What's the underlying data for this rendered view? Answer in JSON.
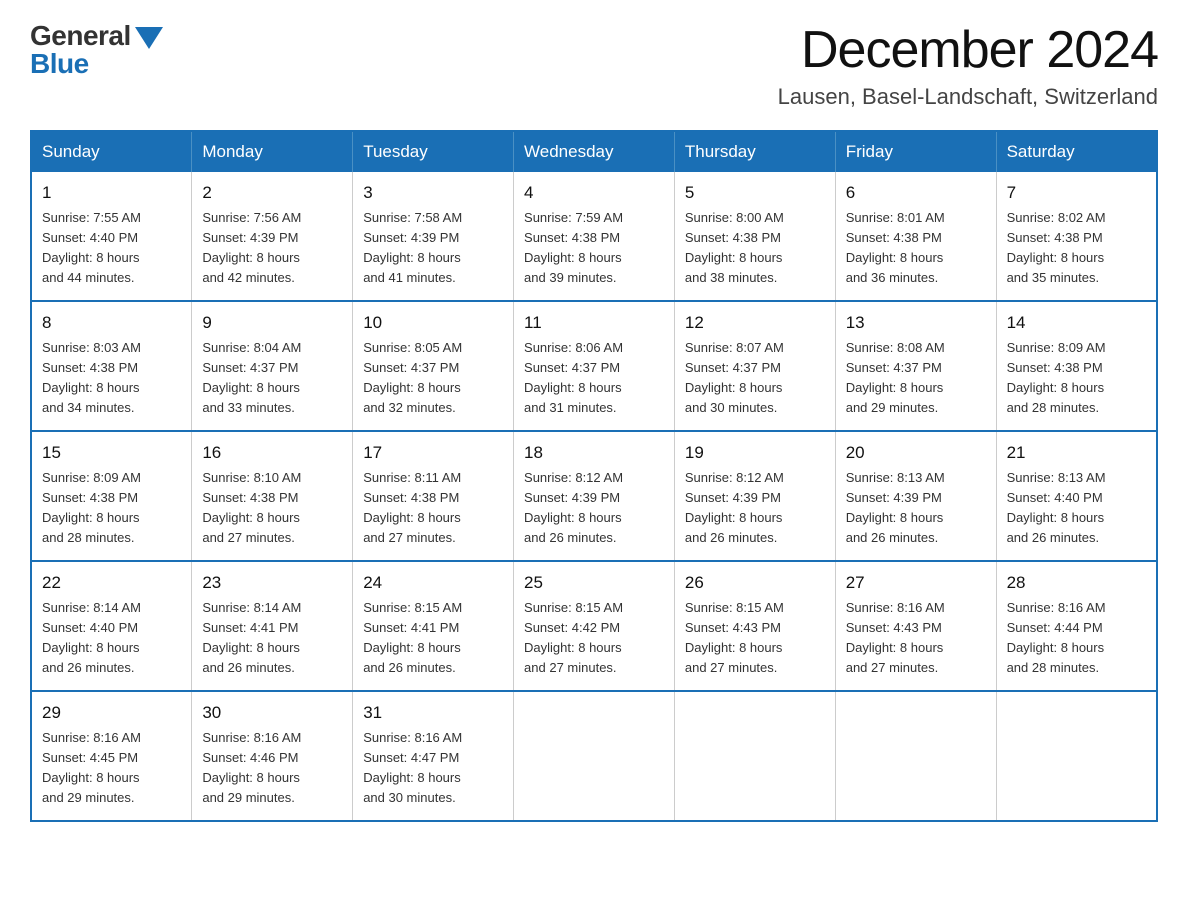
{
  "header": {
    "logo_general": "General",
    "logo_blue": "Blue",
    "month_title": "December 2024",
    "location": "Lausen, Basel-Landschaft, Switzerland"
  },
  "calendar": {
    "days_of_week": [
      "Sunday",
      "Monday",
      "Tuesday",
      "Wednesday",
      "Thursday",
      "Friday",
      "Saturday"
    ],
    "weeks": [
      [
        {
          "day": "1",
          "sunrise": "7:55 AM",
          "sunset": "4:40 PM",
          "daylight": "8 hours and 44 minutes."
        },
        {
          "day": "2",
          "sunrise": "7:56 AM",
          "sunset": "4:39 PM",
          "daylight": "8 hours and 42 minutes."
        },
        {
          "day": "3",
          "sunrise": "7:58 AM",
          "sunset": "4:39 PM",
          "daylight": "8 hours and 41 minutes."
        },
        {
          "day": "4",
          "sunrise": "7:59 AM",
          "sunset": "4:38 PM",
          "daylight": "8 hours and 39 minutes."
        },
        {
          "day": "5",
          "sunrise": "8:00 AM",
          "sunset": "4:38 PM",
          "daylight": "8 hours and 38 minutes."
        },
        {
          "day": "6",
          "sunrise": "8:01 AM",
          "sunset": "4:38 PM",
          "daylight": "8 hours and 36 minutes."
        },
        {
          "day": "7",
          "sunrise": "8:02 AM",
          "sunset": "4:38 PM",
          "daylight": "8 hours and 35 minutes."
        }
      ],
      [
        {
          "day": "8",
          "sunrise": "8:03 AM",
          "sunset": "4:38 PM",
          "daylight": "8 hours and 34 minutes."
        },
        {
          "day": "9",
          "sunrise": "8:04 AM",
          "sunset": "4:37 PM",
          "daylight": "8 hours and 33 minutes."
        },
        {
          "day": "10",
          "sunrise": "8:05 AM",
          "sunset": "4:37 PM",
          "daylight": "8 hours and 32 minutes."
        },
        {
          "day": "11",
          "sunrise": "8:06 AM",
          "sunset": "4:37 PM",
          "daylight": "8 hours and 31 minutes."
        },
        {
          "day": "12",
          "sunrise": "8:07 AM",
          "sunset": "4:37 PM",
          "daylight": "8 hours and 30 minutes."
        },
        {
          "day": "13",
          "sunrise": "8:08 AM",
          "sunset": "4:37 PM",
          "daylight": "8 hours and 29 minutes."
        },
        {
          "day": "14",
          "sunrise": "8:09 AM",
          "sunset": "4:38 PM",
          "daylight": "8 hours and 28 minutes."
        }
      ],
      [
        {
          "day": "15",
          "sunrise": "8:09 AM",
          "sunset": "4:38 PM",
          "daylight": "8 hours and 28 minutes."
        },
        {
          "day": "16",
          "sunrise": "8:10 AM",
          "sunset": "4:38 PM",
          "daylight": "8 hours and 27 minutes."
        },
        {
          "day": "17",
          "sunrise": "8:11 AM",
          "sunset": "4:38 PM",
          "daylight": "8 hours and 27 minutes."
        },
        {
          "day": "18",
          "sunrise": "8:12 AM",
          "sunset": "4:39 PM",
          "daylight": "8 hours and 26 minutes."
        },
        {
          "day": "19",
          "sunrise": "8:12 AM",
          "sunset": "4:39 PM",
          "daylight": "8 hours and 26 minutes."
        },
        {
          "day": "20",
          "sunrise": "8:13 AM",
          "sunset": "4:39 PM",
          "daylight": "8 hours and 26 minutes."
        },
        {
          "day": "21",
          "sunrise": "8:13 AM",
          "sunset": "4:40 PM",
          "daylight": "8 hours and 26 minutes."
        }
      ],
      [
        {
          "day": "22",
          "sunrise": "8:14 AM",
          "sunset": "4:40 PM",
          "daylight": "8 hours and 26 minutes."
        },
        {
          "day": "23",
          "sunrise": "8:14 AM",
          "sunset": "4:41 PM",
          "daylight": "8 hours and 26 minutes."
        },
        {
          "day": "24",
          "sunrise": "8:15 AM",
          "sunset": "4:41 PM",
          "daylight": "8 hours and 26 minutes."
        },
        {
          "day": "25",
          "sunrise": "8:15 AM",
          "sunset": "4:42 PM",
          "daylight": "8 hours and 27 minutes."
        },
        {
          "day": "26",
          "sunrise": "8:15 AM",
          "sunset": "4:43 PM",
          "daylight": "8 hours and 27 minutes."
        },
        {
          "day": "27",
          "sunrise": "8:16 AM",
          "sunset": "4:43 PM",
          "daylight": "8 hours and 27 minutes."
        },
        {
          "day": "28",
          "sunrise": "8:16 AM",
          "sunset": "4:44 PM",
          "daylight": "8 hours and 28 minutes."
        }
      ],
      [
        {
          "day": "29",
          "sunrise": "8:16 AM",
          "sunset": "4:45 PM",
          "daylight": "8 hours and 29 minutes."
        },
        {
          "day": "30",
          "sunrise": "8:16 AM",
          "sunset": "4:46 PM",
          "daylight": "8 hours and 29 minutes."
        },
        {
          "day": "31",
          "sunrise": "8:16 AM",
          "sunset": "4:47 PM",
          "daylight": "8 hours and 30 minutes."
        },
        null,
        null,
        null,
        null
      ]
    ],
    "labels": {
      "sunrise": "Sunrise:",
      "sunset": "Sunset:",
      "daylight": "Daylight:"
    }
  }
}
